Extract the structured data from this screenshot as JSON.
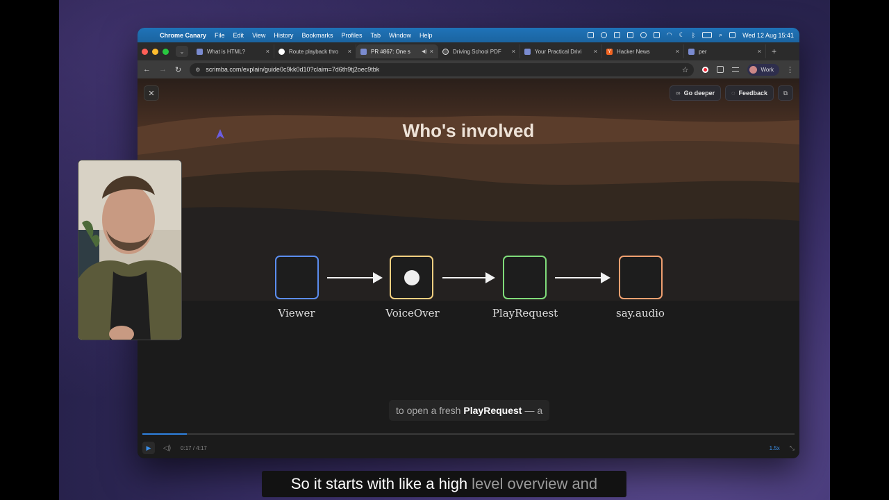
{
  "menubar": {
    "app_name": "Chrome Canary",
    "items": [
      "File",
      "Edit",
      "View",
      "History",
      "Bookmarks",
      "Profiles",
      "Tab",
      "Window",
      "Help"
    ],
    "clock": "Wed 12 Aug  15:41"
  },
  "tabs": [
    {
      "title": "What is HTML?",
      "icon": "scrimba-icon",
      "active": false
    },
    {
      "title": "Route playback thro",
      "icon": "github-icon",
      "active": false
    },
    {
      "title": "PR #867: One s",
      "icon": "scrimba-icon",
      "active": true,
      "sound": true
    },
    {
      "title": "Driving School PDF",
      "icon": "openai-icon",
      "active": false
    },
    {
      "title": "Your Practical Drivi",
      "icon": "scrimba-icon",
      "active": false
    },
    {
      "title": "Hacker News",
      "icon": "hackernews-icon",
      "active": false
    },
    {
      "title": "per",
      "icon": "scrimba-icon",
      "active": false
    }
  ],
  "toolbar": {
    "url": "scrimba.com/explain/guide0c9kk0d10?claim=7d6th9tj2oec9tbk",
    "profile": "Work"
  },
  "page": {
    "title": "Who's involved",
    "go_deeper": "Go deeper",
    "feedback": "Feedback"
  },
  "diagram": {
    "nodes": [
      {
        "label": "Viewer",
        "color": "#5b8def"
      },
      {
        "label": "VoiceOver",
        "color": "#f3cf80"
      },
      {
        "label": "PlayRequest",
        "color": "#7fdc7a"
      },
      {
        "label": "say.audio",
        "color": "#f0a070"
      }
    ]
  },
  "caption": {
    "before": "to open a fresh",
    "highlight": "PlayRequest",
    "after": "— a"
  },
  "player": {
    "time": "0:17 / 4:17",
    "speed": "1.5x",
    "progress_fraction": 0.068
  },
  "subtitle": {
    "main": "So it starts with like a high",
    "faded": "level overview and"
  }
}
